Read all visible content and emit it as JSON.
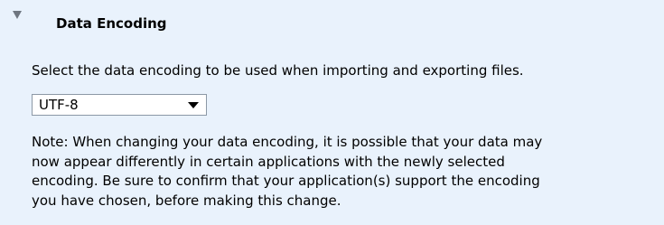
{
  "section": {
    "title": "Data Encoding",
    "icon": "collapse-triangle-icon"
  },
  "description": "Select the data encoding to be used when importing and exporting files.",
  "encoding_select": {
    "value": "UTF-8",
    "icon": "dropdown-arrow-icon"
  },
  "note": {
    "lines": [
      "Note: When changing your data encoding, it is possible that your data may",
      "now appear differently in certain applications with the newly selected",
      "encoding. Be sure to confirm that your application(s) support the encoding",
      "you have chosen, before making this change."
    ]
  },
  "colors": {
    "panel_background": "#e9f2fc",
    "text": "#000000",
    "select_border": "#8c98a6",
    "collapse_icon": "#6f7680"
  }
}
